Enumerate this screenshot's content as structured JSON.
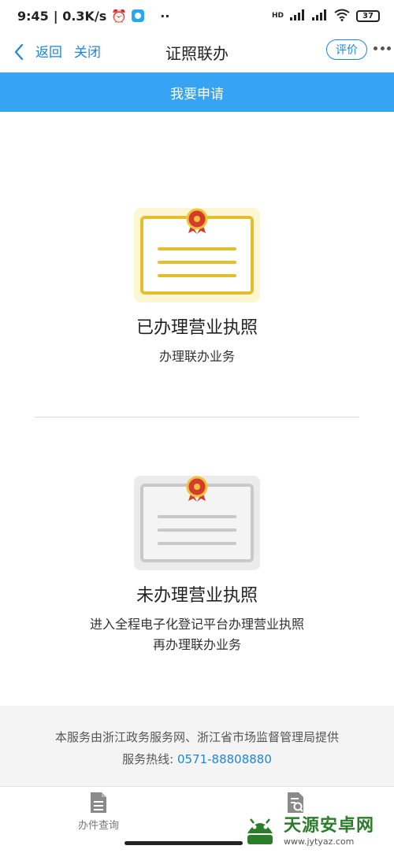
{
  "status_bar": {
    "time": "9:45",
    "net_speed": "| 0.3K/s",
    "dots": "··",
    "signal_label": "HD",
    "battery": "37"
  },
  "nav": {
    "back_label": "返回",
    "close_label": "关闭",
    "title": "证照联办",
    "rate_label": "评价"
  },
  "apply_bar": {
    "label": "我要申请"
  },
  "options": [
    {
      "title": "已办理营业执照",
      "subtitle": "办理联办业务"
    },
    {
      "title": "未办理营业执照",
      "subtitle": "进入全程电子化登记平台办理营业执照再办理联办业务"
    }
  ],
  "footer": {
    "provider_text": "本服务由浙江政务服务网、浙江省市场监督管理局提供",
    "hotline_label": "服务热线:",
    "hotline_number": "0571-88808880"
  },
  "tabbar": {
    "tabs": [
      {
        "label": "办件查询",
        "icon": "document-icon"
      },
      {
        "label": "",
        "icon": "document-search-icon"
      }
    ]
  },
  "watermark": {
    "cn": "天源安卓网",
    "en": "www.jytyaz.com"
  },
  "colors": {
    "accent": "#1d86d9",
    "apply_bar": "#36a3f3",
    "cert_active_frame": "#e3bf2f",
    "cert_active_bg": "#fdf6d3",
    "cert_inactive_frame": "#c9c9c9",
    "cert_inactive_bg": "#ebebeb"
  }
}
